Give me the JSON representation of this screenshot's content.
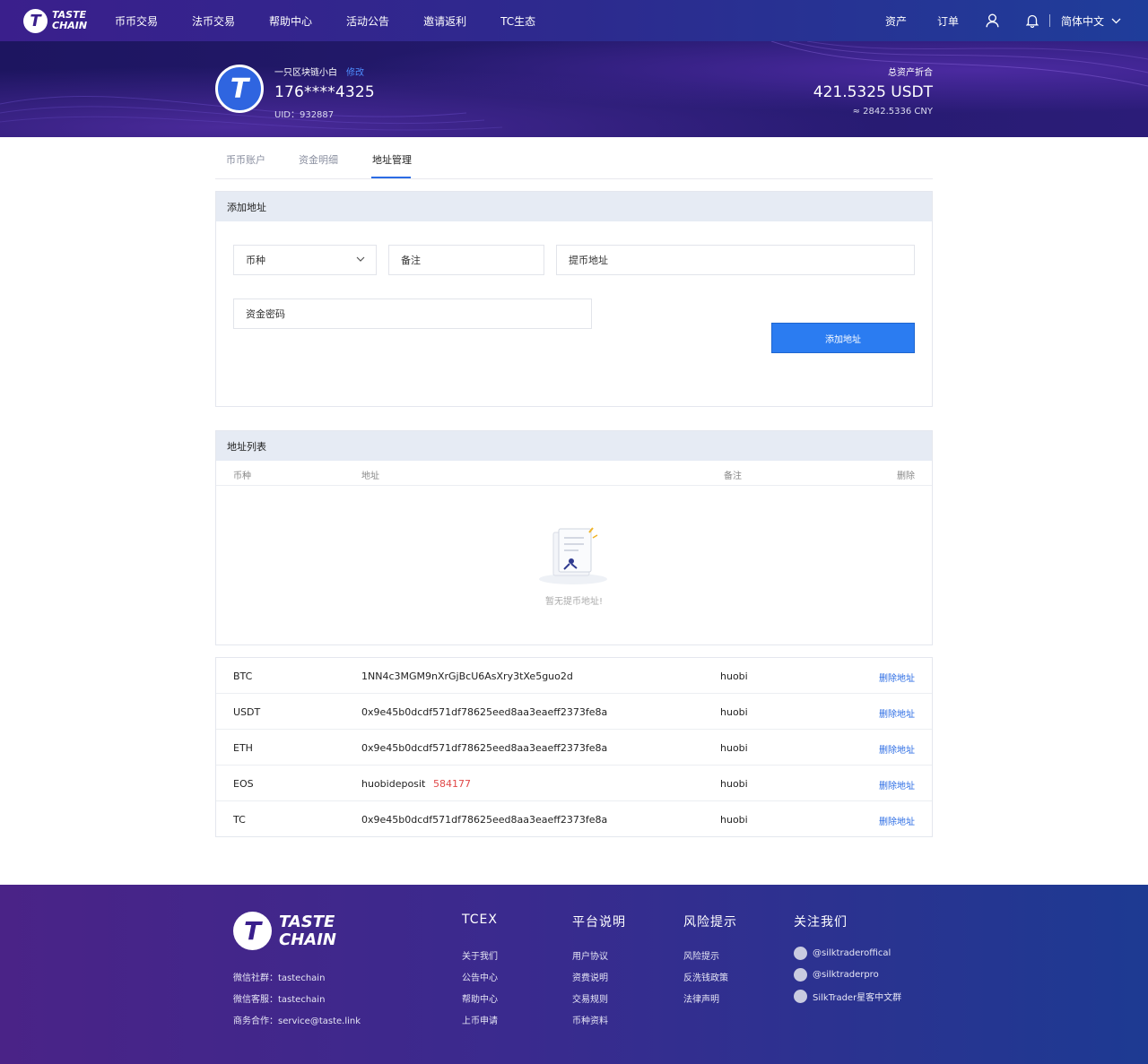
{
  "brand": {
    "logo_line1": "TASTE",
    "logo_line2": "CHAIN"
  },
  "nav": {
    "items": [
      "币币交易",
      "法币交易",
      "帮助中心",
      "活动公告",
      "邀请返利",
      "TC生态"
    ],
    "assets": "资产",
    "orders": "订单",
    "language": "简体中文"
  },
  "user": {
    "nickname": "一只区块链小白",
    "edit_label": "修改",
    "phone": "176****4325",
    "uid": "UID：932887"
  },
  "assets": {
    "title": "总资产折合",
    "usdt": "421.5325 USDT",
    "cny": "≈ 2842.5336 CNY"
  },
  "tabs": [
    "币币账户",
    "资金明细",
    "地址管理"
  ],
  "add_form": {
    "title": "添加地址",
    "coin_placeholder": "币种",
    "memo_placeholder": "备注",
    "address_placeholder": "提币地址",
    "password_placeholder": "资金密码",
    "submit_label": "添加地址"
  },
  "address_list": {
    "title": "地址列表",
    "columns": [
      "币种",
      "地址",
      "备注",
      "删除"
    ],
    "empty_text": "暂无提币地址!"
  },
  "rows": [
    {
      "coin": "BTC",
      "address": "1NN4c3MGM9nXrGjBcU6AsXry3tXe5guo2d",
      "tag": "",
      "memo": "huobi",
      "action": "删除地址"
    },
    {
      "coin": "USDT",
      "address": "0x9e45b0dcdf571df78625eed8aa3eaeff2373fe8a",
      "tag": "",
      "memo": "huobi",
      "action": "删除地址"
    },
    {
      "coin": "ETH",
      "address": "0x9e45b0dcdf571df78625eed8aa3eaeff2373fe8a",
      "tag": "",
      "memo": "huobi",
      "action": "删除地址"
    },
    {
      "coin": "EOS",
      "address": "huobideposit",
      "tag": "584177",
      "memo": "huobi",
      "action": "删除地址"
    },
    {
      "coin": "TC",
      "address": "0x9e45b0dcdf571df78625eed8aa3eaeff2373fe8a",
      "tag": "",
      "memo": "huobi",
      "action": "删除地址"
    }
  ],
  "footer": {
    "logo_line1": "TASTE",
    "logo_line2": "CHAIN",
    "contacts": [
      "微信社群：tastechain",
      "微信客服：tastechain",
      "商务合作：service@taste.link"
    ],
    "columns": [
      {
        "title": "TCEX",
        "links": [
          "关于我们",
          "公告中心",
          "帮助中心",
          "上币申请"
        ]
      },
      {
        "title": "平台说明",
        "links": [
          "用户协议",
          "资费说明",
          "交易规则",
          "币种资料"
        ]
      },
      {
        "title": "风险提示",
        "links": [
          "风险提示",
          "反洗钱政策",
          "法律声明"
        ]
      },
      {
        "title": "关注我们",
        "links": [
          "@silktraderoffical",
          "@silktraderpro",
          "SilkTrader星客中文群"
        ]
      }
    ]
  },
  "colors": {
    "accent": "#2b7cf1",
    "link": "#2b6ce4",
    "danger": "#e04848"
  }
}
